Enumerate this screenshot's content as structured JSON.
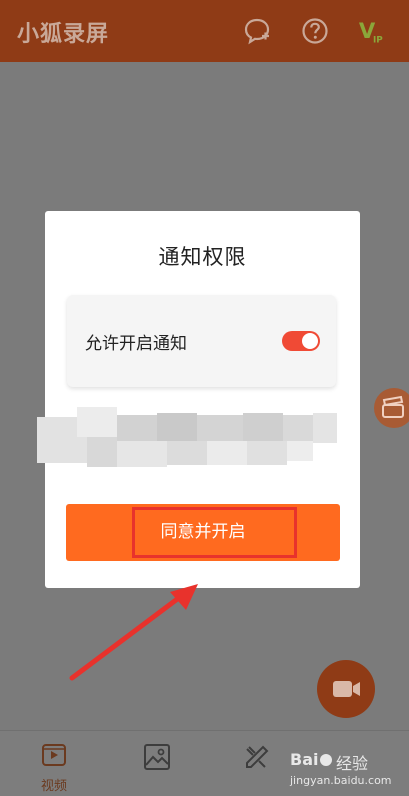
{
  "header": {
    "title": "小狐录屏",
    "icons": [
      "chat-add-icon",
      "help-icon",
      "vip-icon"
    ],
    "vip_text": "V",
    "vip_sub": "IP"
  },
  "dialog": {
    "title": "通知权限",
    "toggle": {
      "label": "允许开启通知",
      "state": "on"
    },
    "agree_label": "同意并开启"
  },
  "bottom_nav": {
    "items": [
      {
        "label": "视频",
        "icon": "video-icon",
        "active": true
      },
      {
        "label": "",
        "icon": "image-icon",
        "active": false
      },
      {
        "label": "",
        "icon": "tools-icon",
        "active": false
      }
    ]
  },
  "watermark": {
    "text": "经验",
    "url": "jingyan.baidu.com",
    "brand": "Bai"
  },
  "colors": {
    "accent": "#ff6a1f",
    "toggle": "#f04a35",
    "highlight": "#e8322c",
    "header": "#8f3b16"
  }
}
